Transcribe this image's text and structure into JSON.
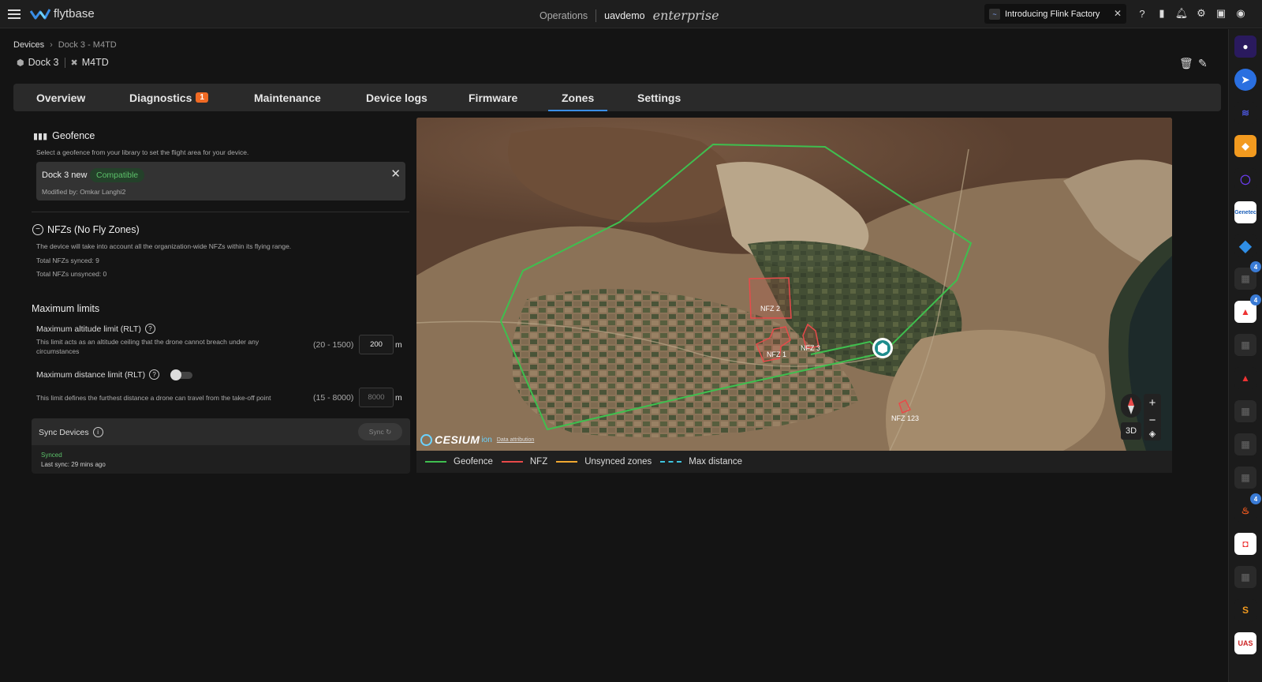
{
  "topbar": {
    "logo_text": "flytbase",
    "operations": "Operations",
    "org": "uavdemo",
    "brand": "enterprise",
    "announcement": "Introducing Flink Factory"
  },
  "breadcrumb": {
    "root": "Devices",
    "current": "Dock 3 - M4TD"
  },
  "device": {
    "dock": "Dock 3",
    "drone": "M4TD"
  },
  "tabs": [
    {
      "label": "Overview"
    },
    {
      "label": "Diagnostics",
      "badge": "1"
    },
    {
      "label": "Maintenance"
    },
    {
      "label": "Device logs"
    },
    {
      "label": "Firmware"
    },
    {
      "label": "Zones",
      "active": true
    },
    {
      "label": "Settings"
    }
  ],
  "geofence": {
    "title": "Geofence",
    "subtitle": "Select a geofence from your library to set the flight area for your device.",
    "selected_name": "Dock 3 new",
    "status": "Compatible",
    "modified_by": "Modified by: Omkar Langhi2"
  },
  "nfz": {
    "title": "NFZs (No Fly Zones)",
    "description": "The device will take into account all the organization-wide NFZs within its flying range.",
    "synced": "Total NFZs synced: 9",
    "unsynced": "Total NFZs unsynced: 0"
  },
  "limits": {
    "title": "Maximum limits",
    "altitude_label": "Maximum altitude limit (RLT)",
    "altitude_desc": "This limit acts as an altitude ceiling that the drone cannot breach under any circumstances",
    "altitude_range": "(20 - 1500)",
    "altitude_value": "200",
    "altitude_unit": "m",
    "distance_label": "Maximum distance limit (RLT)",
    "distance_enabled": false,
    "distance_desc": "This limit defines the furthest distance a drone can travel from the take-off point",
    "distance_range": "(15 - 8000)",
    "distance_placeholder": "8000",
    "distance_unit": "m"
  },
  "sync": {
    "title": "Sync Devices",
    "button": "Sync",
    "status": "Synced",
    "last_sync": "Last sync: 29 mins ago"
  },
  "map": {
    "zones": [
      "NFZ 2",
      "NFZ 1",
      "NFZ 3",
      "NFZ 123"
    ],
    "view_button": "3D",
    "attribution_logo": "CESIUM",
    "attribution_ion": "ion",
    "attribution_link": "Data attribution"
  },
  "legend": [
    {
      "label": "Geofence",
      "color": "#3fbf4f",
      "style": "solid"
    },
    {
      "label": "NFZ",
      "color": "#e84a4a",
      "style": "solid"
    },
    {
      "label": "Unsynced zones",
      "color": "#f0a830",
      "style": "solid"
    },
    {
      "label": "Max distance",
      "color": "#3fc6e0",
      "style": "dashed"
    }
  ],
  "rail": {
    "badges": [
      "4",
      "4",
      "4"
    ]
  }
}
